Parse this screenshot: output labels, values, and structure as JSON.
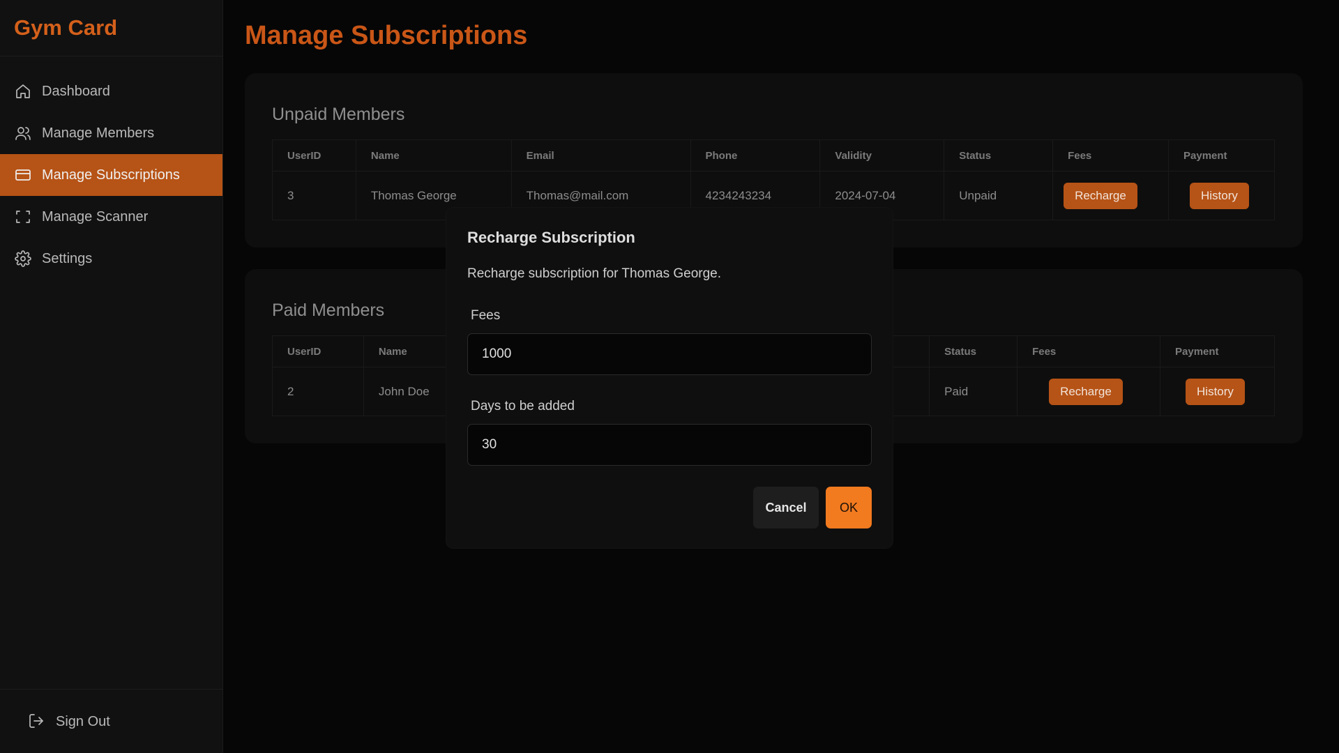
{
  "app": {
    "title": "Gym Card"
  },
  "sidebar": {
    "items": [
      {
        "label": "Dashboard",
        "icon": "home-icon"
      },
      {
        "label": "Manage Members",
        "icon": "users-icon"
      },
      {
        "label": "Manage Subscriptions",
        "icon": "credit-card-icon",
        "active": true
      },
      {
        "label": "Manage Scanner",
        "icon": "scan-icon"
      },
      {
        "label": "Settings",
        "icon": "gear-icon"
      }
    ],
    "signout": {
      "label": "Sign Out",
      "icon": "logout-icon"
    }
  },
  "page": {
    "title": "Manage Subscriptions"
  },
  "unpaid": {
    "title": "Unpaid Members",
    "headers": [
      "UserID",
      "Name",
      "Email",
      "Phone",
      "Validity",
      "Status",
      "Fees",
      "Payment"
    ],
    "rows": [
      {
        "userid": "3",
        "name": "Thomas George",
        "email": "Thomas@mail.com",
        "phone": "4234243234",
        "validity": "2024-07-04",
        "status": "Unpaid",
        "fees_btn": "Recharge",
        "payment_btn": "History"
      }
    ]
  },
  "paid": {
    "title": "Paid Members",
    "headers": [
      "UserID",
      "Name",
      "Status",
      "Fees",
      "Payment"
    ],
    "rows": [
      {
        "userid": "2",
        "name": "John Doe",
        "status": "Paid",
        "fees_btn": "Recharge",
        "payment_btn": "History"
      }
    ]
  },
  "modal": {
    "title": "Recharge Subscription",
    "description": "Recharge subscription for Thomas George.",
    "fees_label": "Fees",
    "fees_value": "1000",
    "days_label": "Days to be added",
    "days_value": "30",
    "cancel_label": "Cancel",
    "ok_label": "OK"
  },
  "colors": {
    "accent": "#c95617",
    "active_nav": "#b65316",
    "ok_button": "#f27a1f",
    "background": "#060606"
  }
}
